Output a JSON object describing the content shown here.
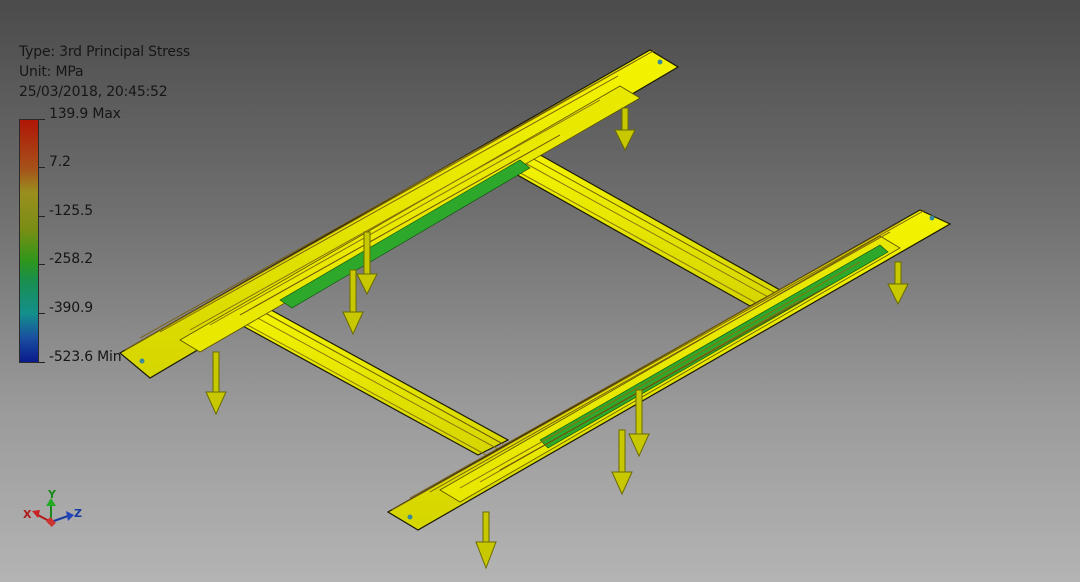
{
  "result_header": {
    "type_line": "Type: 3rd Principal Stress",
    "unit_line": "Unit: MPa",
    "timestamp": "25/03/2018, 20:45:52"
  },
  "legend": {
    "labels": [
      "139.9 Max",
      "7.2",
      "-125.5",
      "-258.2",
      "-390.9",
      "-523.6 Min"
    ],
    "colors": {
      "max": "#b01606",
      "mid": "#2f961a",
      "min": "#0a1a8c"
    }
  },
  "axis_triad": {
    "x": "X",
    "y": "Y",
    "z": "Z"
  },
  "model": {
    "part_color": "#f0f000",
    "edge_color": "#8a6a10",
    "load_arrow_color": "#c8c800",
    "load_arrow_count": 8
  },
  "colors": {
    "background_top": "#4b4b4b",
    "background_bottom": "#b4b4b4"
  }
}
